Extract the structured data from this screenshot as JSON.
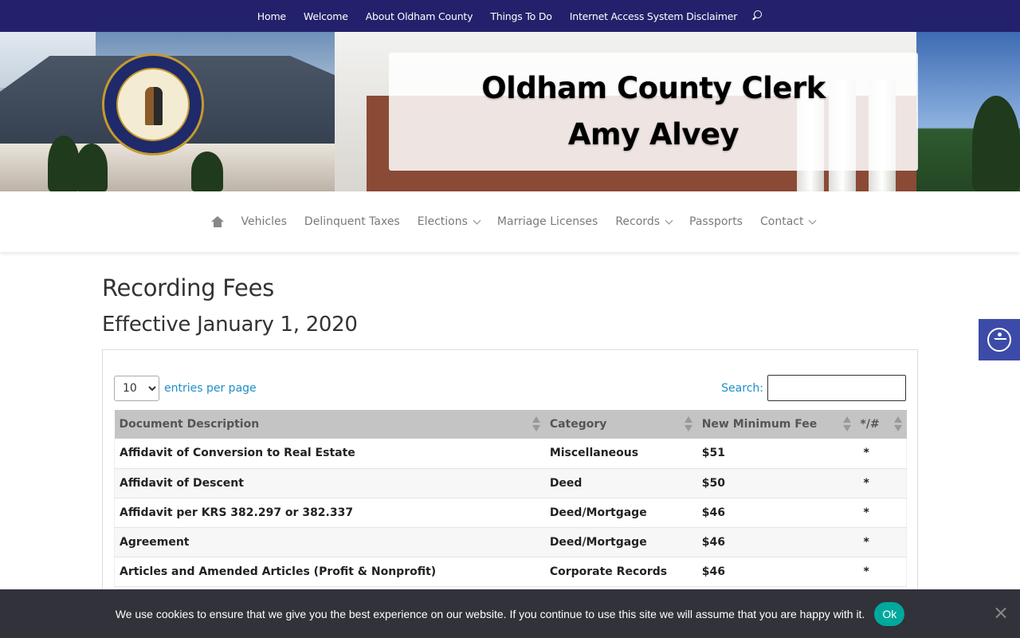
{
  "topnav": {
    "items": [
      "Home",
      "Welcome",
      "About Oldham County",
      "Things To Do",
      "Internet Access System Disclaimer"
    ],
    "search_icon": "search-icon"
  },
  "hero": {
    "title_line1": "Oldham County Clerk",
    "title_line2": "Amy Alvey",
    "seal_icon": "kentucky-seal"
  },
  "mainnav": {
    "home_icon": "home-icon",
    "items": [
      {
        "label": "Vehicles",
        "dropdown": false
      },
      {
        "label": "Delinquent Taxes",
        "dropdown": false
      },
      {
        "label": "Elections",
        "dropdown": true
      },
      {
        "label": "Marriage Licenses",
        "dropdown": false
      },
      {
        "label": "Records",
        "dropdown": true
      },
      {
        "label": "Passports",
        "dropdown": false
      },
      {
        "label": "Contact",
        "dropdown": true
      }
    ]
  },
  "content": {
    "title": "Recording Fees",
    "subtitle": "Effective January 1, 2020"
  },
  "table_controls": {
    "entries_value": "10",
    "entries_label": "entries per page",
    "search_label": "Search:",
    "search_value": ""
  },
  "table": {
    "columns": [
      "Document Description",
      "Category",
      "New Minimum Fee",
      "*/#"
    ],
    "rows": [
      [
        "Affidavit of Conversion to Real Estate",
        "Miscellaneous",
        "$51",
        "*"
      ],
      [
        "Affidavit of Descent",
        "Deed",
        "$50",
        "*"
      ],
      [
        "Affidavit per KRS 382.297 or 382.337",
        "Deed/Mortgage",
        "$46",
        "*"
      ],
      [
        "Agreement",
        "Deed/Mortgage",
        "$46",
        "*"
      ],
      [
        "Articles and Amended Articles (Profit & Nonprofit)",
        "Corporate Records",
        "$46",
        "*"
      ]
    ]
  },
  "accessibility": {
    "icon": "accessibility-icon"
  },
  "cookie": {
    "message": "We use cookies to ensure that we give you the best experience on our website. If you continue to use this site we will assume that you are happy with it.",
    "ok_label": "Ok",
    "close_icon": "close-icon"
  },
  "colors": {
    "topbar": "#23216b",
    "link": "#1d8fc7",
    "cookie_bg": "#32323a",
    "ok_button": "#00a99d",
    "a11y_button": "#3c4ba8"
  }
}
